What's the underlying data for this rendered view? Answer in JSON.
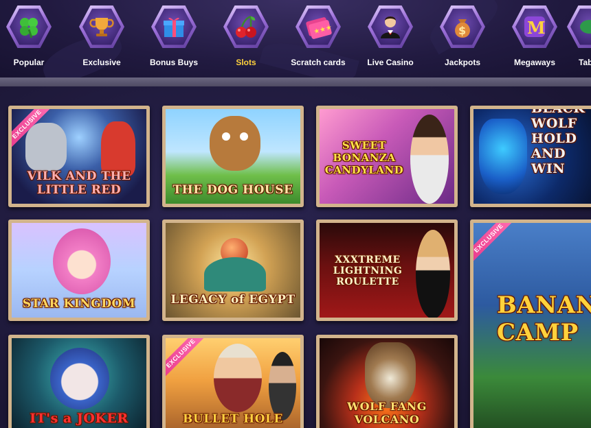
{
  "categories": [
    {
      "label": "Popular",
      "icon": "clover-icon",
      "active": false
    },
    {
      "label": "Exclusive",
      "icon": "trophy-icon",
      "active": false
    },
    {
      "label": "Bonus Buys",
      "icon": "gift-icon",
      "active": false
    },
    {
      "label": "Slots",
      "icon": "cherries-icon",
      "active": true
    },
    {
      "label": "Scratch cards",
      "icon": "scratch-card-icon",
      "active": false
    },
    {
      "label": "Live Casino",
      "icon": "dealer-icon",
      "active": false
    },
    {
      "label": "Jackpots",
      "icon": "money-bag-icon",
      "active": false
    },
    {
      "label": "Megaways",
      "icon": "megaways-m-icon",
      "active": false
    },
    {
      "label": "Tab",
      "icon": "table-games-icon",
      "active": false
    }
  ],
  "games": [
    {
      "title": "VILK AND THE LITTLE RED",
      "badge": "EXCLUSIVE"
    },
    {
      "title": "THE DOG HOUSE",
      "badge": ""
    },
    {
      "title": "SWEET BONANZA CANDYLAND",
      "badge": ""
    },
    {
      "title": "BLACK WOLF HOLD AND WIN",
      "badge": ""
    },
    {
      "title": "STAR KINGDOM",
      "badge": ""
    },
    {
      "title": "LEGACY of EGYPT",
      "badge": ""
    },
    {
      "title": "XXXTREME LIGHTNING ROULETTE",
      "badge": ""
    },
    {
      "title": "BANANA CAMP",
      "badge": "EXCLUSIVE"
    },
    {
      "title": "IT's a JOKER",
      "badge": ""
    },
    {
      "title": "BULLET HOLE",
      "badge": "EXCLUSIVE"
    },
    {
      "title": "WOLF FANG VOLCANO",
      "badge": ""
    }
  ],
  "colors": {
    "active_label": "#ffd23c",
    "badge": "#e8388a",
    "frame": "#d2b48c",
    "background": "#1e1838"
  }
}
